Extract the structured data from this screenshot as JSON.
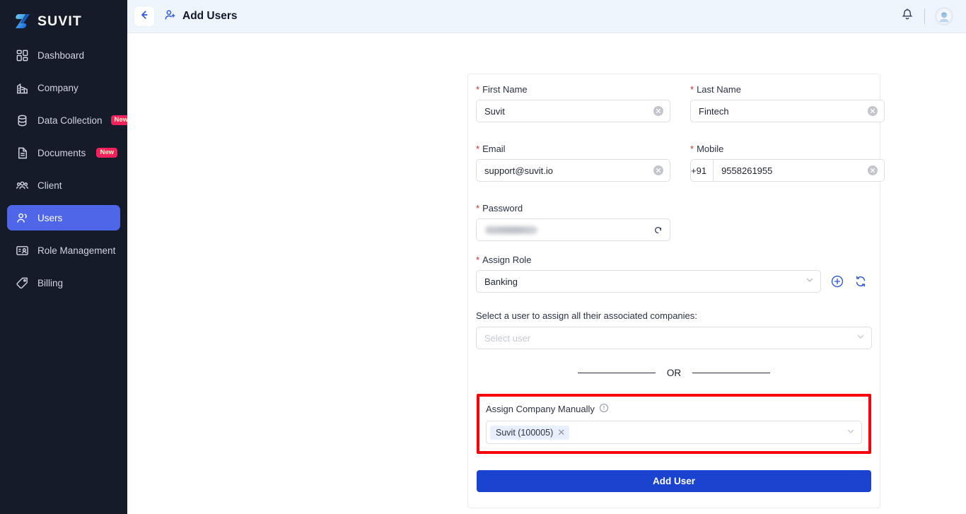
{
  "brand": {
    "name": "SUVIT",
    "logo_icon": "suvit-logo-icon",
    "accent": "#4f66e8"
  },
  "sidebar": {
    "items": [
      {
        "label": "Dashboard",
        "icon": "dashboard-icon",
        "badge": null,
        "active": false
      },
      {
        "label": "Company",
        "icon": "company-icon",
        "badge": null,
        "active": false
      },
      {
        "label": "Data Collection",
        "icon": "database-icon",
        "badge": "New",
        "active": false
      },
      {
        "label": "Documents",
        "icon": "document-icon",
        "badge": "New",
        "active": false
      },
      {
        "label": "Client",
        "icon": "client-group-icon",
        "badge": null,
        "active": false
      },
      {
        "label": "Users",
        "icon": "users-icon",
        "badge": null,
        "active": true
      },
      {
        "label": "Role Management",
        "icon": "role-management-icon",
        "badge": null,
        "active": false
      },
      {
        "label": "Billing",
        "icon": "billing-tag-icon",
        "badge": null,
        "active": false
      }
    ],
    "badge_bg": "#f6215c",
    "badge_color": "#fdf0c8"
  },
  "topbar": {
    "back_icon": "arrow-left-icon",
    "title_icon": "add-user-icon",
    "title": "Add Users",
    "notification_icon": "bell-icon",
    "avatar_icon": "user-avatar-icon"
  },
  "form": {
    "first_name": {
      "label": "First Name",
      "required": true,
      "value": "Suvit",
      "clear_icon": "clear-circle-icon"
    },
    "last_name": {
      "label": "Last Name",
      "required": true,
      "value": "Fintech",
      "clear_icon": "clear-circle-icon"
    },
    "email": {
      "label": "Email",
      "required": true,
      "value": "support@suvit.io",
      "clear_icon": "clear-circle-icon"
    },
    "mobile": {
      "label": "Mobile",
      "required": true,
      "prefix": "+91",
      "value": "9558261955",
      "clear_icon": "clear-circle-icon"
    },
    "password": {
      "label": "Password",
      "required": true,
      "value": "",
      "masked": true,
      "generate_icon": "regenerate-icon"
    },
    "assign_role": {
      "label": "Assign Role",
      "required": true,
      "value": "Banking",
      "add_icon": "plus-circle-icon",
      "refresh_icon": "refresh-icon",
      "chevron_icon": "chevron-down-icon"
    },
    "select_user": {
      "helper": "Select a user to assign all their associated companies:",
      "placeholder": "Select user",
      "chevron_icon": "chevron-down-icon"
    },
    "or_text": "OR",
    "assign_company": {
      "label": "Assign Company Manually",
      "info_icon": "info-circle-icon",
      "highlight_color": "#fb0006",
      "chevron_icon": "chevron-down-icon",
      "tags": [
        {
          "text": "Suvit (100005)",
          "remove_icon": "tag-remove-icon"
        }
      ]
    },
    "submit": {
      "label": "Add User",
      "color": "#1a44cf"
    }
  }
}
